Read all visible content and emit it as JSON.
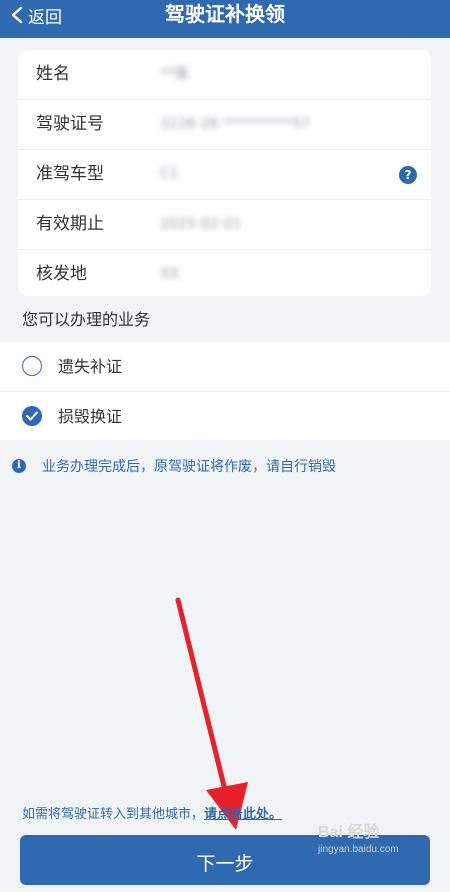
{
  "header": {
    "back_label": "返回",
    "title": "驾驶证补换领"
  },
  "info_rows": [
    {
      "label": "姓名",
      "value": "**强"
    },
    {
      "label": "驾驶证号",
      "value": "3226 28 **********57"
    },
    {
      "label": "准驾车型",
      "value": "C1"
    },
    {
      "label": "有效期止",
      "value": "2025-02-01"
    },
    {
      "label": "核发地",
      "value": "XX"
    }
  ],
  "services": {
    "title": "您可以办理的业务",
    "options": [
      {
        "label": "遗失补证",
        "checked": false
      },
      {
        "label": "损毁换证",
        "checked": true
      }
    ]
  },
  "notice": "业务办理完成后，原驾驶证将作废，请自行销毁",
  "transfer": {
    "text": "如需将驾驶证转入到其他城市，",
    "link": "请点击此处。"
  },
  "next_button": "下一步",
  "watermark": {
    "brand": "Bai 经验",
    "url": "jingyan.baidu.com"
  },
  "colors": {
    "primary": "#2f69b0",
    "background": "#f1f4f6",
    "annotation_arrow": "#e8202a"
  }
}
